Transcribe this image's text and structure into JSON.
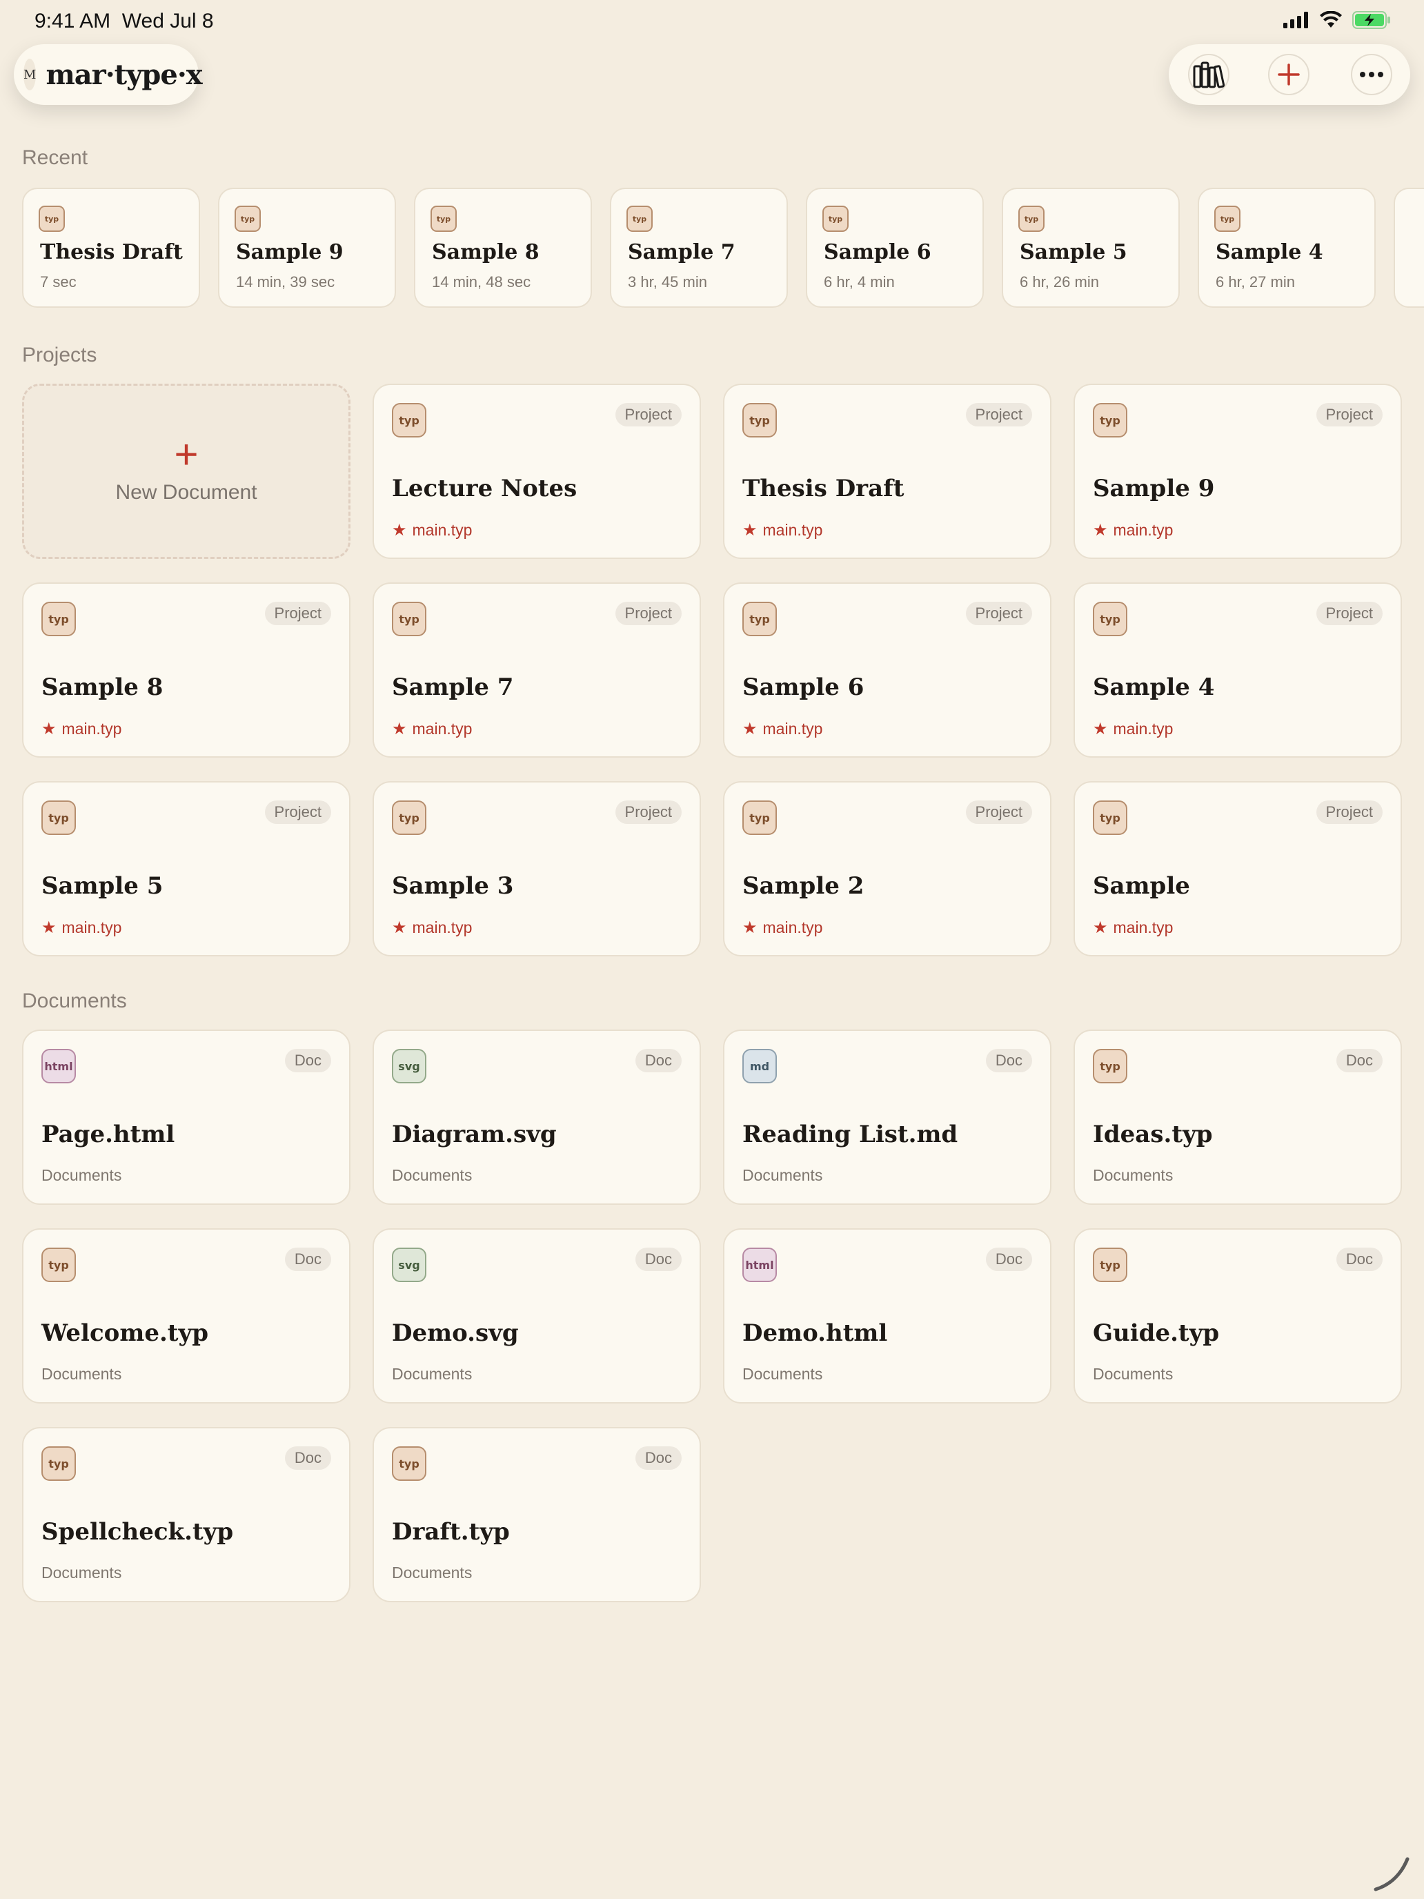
{
  "status": {
    "time": "9:41 AM",
    "date": "Wed Jul 8"
  },
  "brand": {
    "logo_letter": "M",
    "name": "mar·type·x"
  },
  "toolbar": {
    "library_icon": "library-icon",
    "add_icon": "plus-icon",
    "more_icon": "ellipsis-icon"
  },
  "recent": {
    "title": "Recent",
    "items": [
      {
        "icon": "typ",
        "title": "Thesis Draft",
        "sub": "7 sec"
      },
      {
        "icon": "typ",
        "title": "Sample 9",
        "sub": "14 min, 39 sec"
      },
      {
        "icon": "typ",
        "title": "Sample 8",
        "sub": "14 min, 48 sec"
      },
      {
        "icon": "typ",
        "title": "Sample 7",
        "sub": "3 hr, 45 min"
      },
      {
        "icon": "typ",
        "title": "Sample 6",
        "sub": "6 hr, 4 min"
      },
      {
        "icon": "typ",
        "title": "Sample 5",
        "sub": "6 hr, 26 min"
      },
      {
        "icon": "typ",
        "title": "Sample 4",
        "sub": "6 hr, 27 min"
      }
    ]
  },
  "projects": {
    "title": "Projects",
    "new_document_label": "New Document",
    "badge": "Project",
    "items": [
      {
        "icon": "typ",
        "title": "Lecture Notes",
        "sub": "main.typ"
      },
      {
        "icon": "typ",
        "title": "Thesis Draft",
        "sub": "main.typ"
      },
      {
        "icon": "typ",
        "title": "Sample 9",
        "sub": "main.typ"
      },
      {
        "icon": "typ",
        "title": "Sample 8",
        "sub": "main.typ"
      },
      {
        "icon": "typ",
        "title": "Sample 7",
        "sub": "main.typ"
      },
      {
        "icon": "typ",
        "title": "Sample 6",
        "sub": "main.typ"
      },
      {
        "icon": "typ",
        "title": "Sample 4",
        "sub": "main.typ"
      },
      {
        "icon": "typ",
        "title": "Sample 5",
        "sub": "main.typ"
      },
      {
        "icon": "typ",
        "title": "Sample 3",
        "sub": "main.typ"
      },
      {
        "icon": "typ",
        "title": "Sample 2",
        "sub": "main.typ"
      },
      {
        "icon": "typ",
        "title": "Sample",
        "sub": "main.typ"
      }
    ]
  },
  "documents": {
    "title": "Documents",
    "badge": "Doc",
    "items": [
      {
        "icon": "html",
        "title": "Page.html",
        "sub": "Documents"
      },
      {
        "icon": "svg",
        "title": "Diagram.svg",
        "sub": "Documents"
      },
      {
        "icon": "md",
        "title": "Reading List.md",
        "sub": "Documents"
      },
      {
        "icon": "typ",
        "title": "Ideas.typ",
        "sub": "Documents"
      },
      {
        "icon": "typ",
        "title": "Welcome.typ",
        "sub": "Documents"
      },
      {
        "icon": "svg",
        "title": "Demo.svg",
        "sub": "Documents"
      },
      {
        "icon": "html",
        "title": "Demo.html",
        "sub": "Documents"
      },
      {
        "icon": "typ",
        "title": "Guide.typ",
        "sub": "Documents"
      },
      {
        "icon": "typ",
        "title": "Spellcheck.typ",
        "sub": "Documents"
      },
      {
        "icon": "typ",
        "title": "Draft.typ",
        "sub": "Documents"
      }
    ]
  },
  "colors": {
    "accent": "#c0392b",
    "background": "#f4ede0",
    "card": "#fcf9f1"
  }
}
